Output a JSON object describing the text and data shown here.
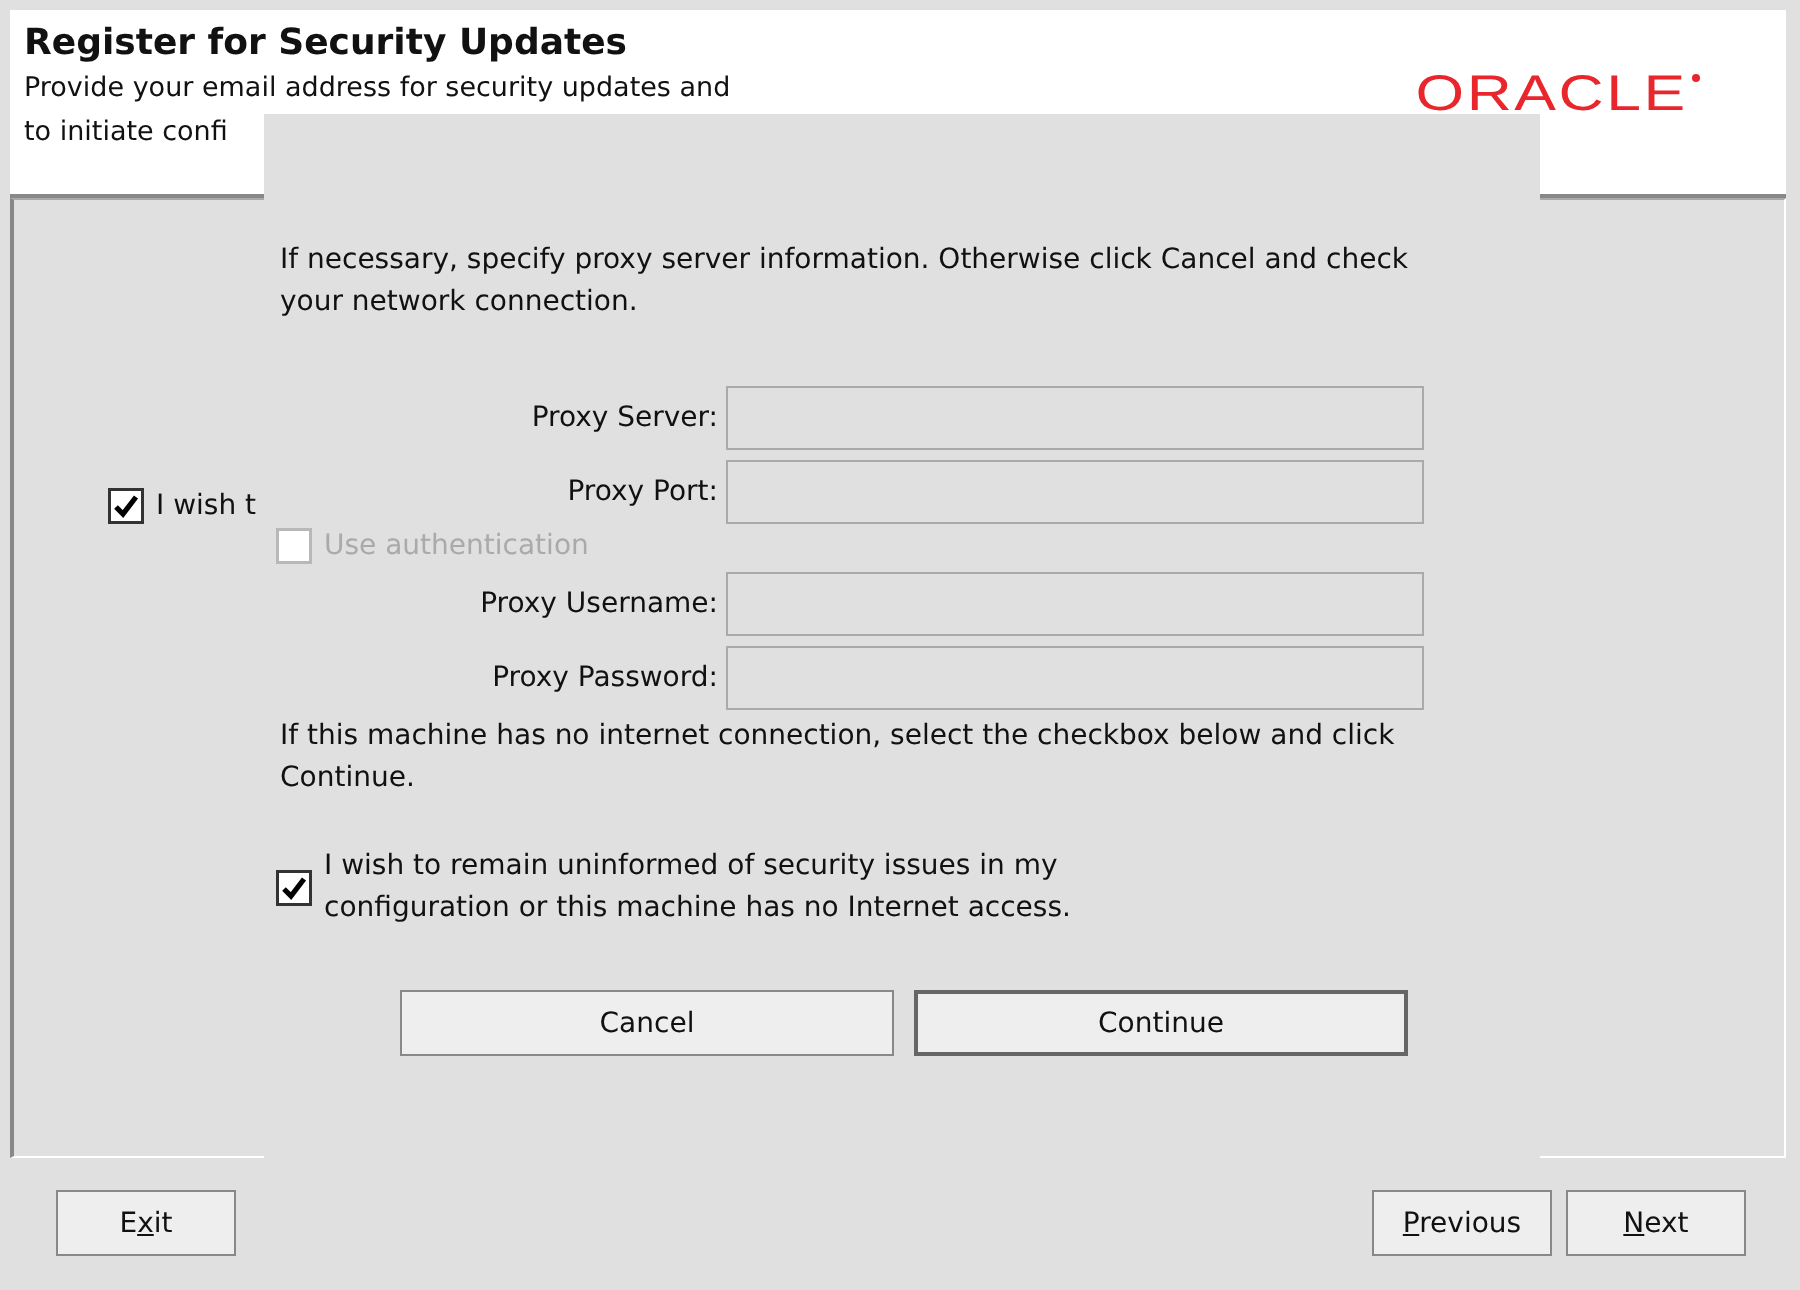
{
  "header": {
    "title": "Register for Security Updates",
    "description_lines": [
      "Provide your email address for security updates and",
      "to initiate confi"
    ],
    "logo": "ORACLE"
  },
  "background_checkbox": {
    "label": "I wish t",
    "checked": true
  },
  "footer_left_buttons": [
    {
      "before": "E",
      "mnemonic": "x",
      "after": "it"
    }
  ],
  "footer_right_buttons": [
    {
      "mnemonic": "P",
      "after": "revious"
    },
    {
      "mnemonic": "N",
      "after": "ext"
    }
  ],
  "dialog": {
    "intro": "If necessary, specify proxy server information. Otherwise click Cancel and check your network connection.",
    "rows": [
      {
        "kind": "field",
        "label": "Proxy Server:"
      },
      {
        "kind": "field",
        "label": "Proxy Port:"
      },
      {
        "kind": "checkbox",
        "label": "Use  authentication",
        "checked": false,
        "disabled": true
      },
      {
        "kind": "field",
        "label": "Proxy Username:"
      },
      {
        "kind": "field",
        "label": "Proxy Password:"
      }
    ],
    "note": "If this machine has no internet connection, select the checkbox below and click Continue.",
    "offline_checkbox": {
      "label": "I wish to remain uninformed of security issues in my configuration or this machine has no Internet access.",
      "checked": true
    },
    "buttons": [
      {
        "label": "Cancel",
        "default": false
      },
      {
        "label": "Continue",
        "default": true
      }
    ]
  }
}
